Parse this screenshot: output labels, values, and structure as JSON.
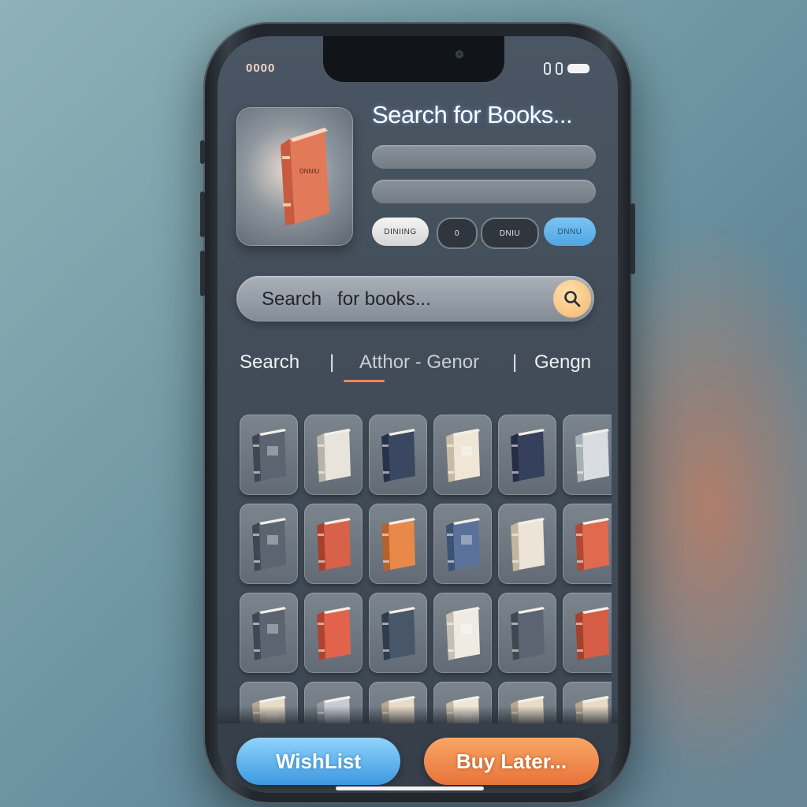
{
  "status_bar": {
    "left_text": "0000"
  },
  "header": {
    "title": "Search for Books...",
    "cover_label": "DNNIU",
    "chips": [
      {
        "label": "DINIING"
      },
      {
        "label": "0"
      },
      {
        "label": "DNIU"
      },
      {
        "label": "DNNU"
      }
    ]
  },
  "search": {
    "placeholder": "Search   for books..."
  },
  "tabs": {
    "search": "Search",
    "separator": "|",
    "author": "Atthor - Genor",
    "genre": "Gengn"
  },
  "actions": {
    "wishlist": "WishList",
    "buy_later": "Buy Later..."
  },
  "colors": {
    "accent_orange": "#f08a4b",
    "accent_blue": "#4fa6e2",
    "screen_bg": "#424d59"
  }
}
